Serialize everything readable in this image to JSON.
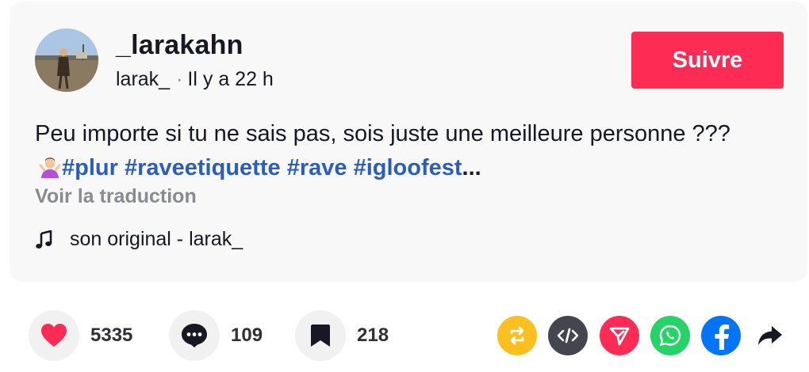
{
  "author": {
    "username": "_larakahn",
    "handle": "larak_",
    "separator": "·",
    "time_ago": "Il y a 22 h"
  },
  "follow_button": {
    "label": "Suivre",
    "color": "#fe2c55"
  },
  "caption": {
    "text": "Peu importe si tu ne sais pas, sois juste une meilleure personne ??? ",
    "emoji": "person-shrugging",
    "hashtags": [
      "#plur",
      "#raveetiquette",
      "#rave",
      "#igloofest"
    ],
    "ellipsis": "..."
  },
  "translate_link": "Voir la traduction",
  "music": {
    "icon": "music-note-icon",
    "label": "son original - larak_"
  },
  "actions": {
    "likes": {
      "icon": "heart-icon",
      "count": "5335",
      "color": "#fe2c55"
    },
    "comments": {
      "icon": "comment-icon",
      "count": "109"
    },
    "saves": {
      "icon": "bookmark-icon",
      "count": "218"
    }
  },
  "share_buttons": [
    {
      "name": "repost",
      "icon": "repost-icon",
      "color": "#fcbf20"
    },
    {
      "name": "embed",
      "icon": "embed-icon",
      "color": "#454550"
    },
    {
      "name": "send-to-friends",
      "icon": "send-icon",
      "color": "#fe2c55"
    },
    {
      "name": "whatsapp",
      "icon": "whatsapp-icon",
      "color": "#25d366"
    },
    {
      "name": "facebook",
      "icon": "facebook-icon",
      "color": "#0075fa"
    },
    {
      "name": "more-share",
      "icon": "share-arrow-icon",
      "color": "#161823"
    }
  ]
}
